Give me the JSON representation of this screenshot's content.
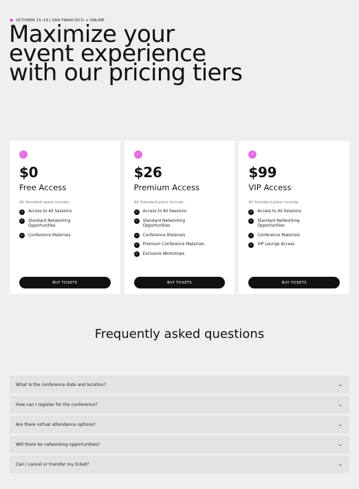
{
  "header": {
    "eyebrow": "OCTOBER 15–19 | SAN FRANCISCO + ONLINE",
    "title": "Maximize your event experience with our pricing tiers"
  },
  "accent_color": "#e26fe0",
  "pricing": [
    {
      "price": "$0",
      "name": "Free Access",
      "note": "All Standard plans include:",
      "features": [
        "Access to All Sessions",
        "Standard Networking Opportunities",
        "Conference Materials"
      ],
      "button": "BUY TICKETS"
    },
    {
      "price": "$26",
      "name": "Premium Access",
      "note": "All Standard plans include:",
      "features": [
        "Access to All Sessions",
        "Standard Networking Opportunities",
        "Conference Materials",
        "Premium Conference Materials",
        "Exclusive Workshops"
      ],
      "button": "BUY TICKETS"
    },
    {
      "price": "$99",
      "name": "VIP Access",
      "note": "All Standard plans include:",
      "features": [
        "Access to All Sessions",
        "Standard Networking Opportunities",
        "Conference Materials",
        "VIP Lounge Access"
      ],
      "button": "BUY TICKETS"
    }
  ],
  "faq": {
    "title": "Frequently asked questions",
    "items": [
      "What is the conference date and location?",
      "How can I register for the conference?",
      "Are there virtual attendance options?",
      "Will there be networking opportunities?",
      "Can I cancel or transfer my ticket?"
    ]
  }
}
